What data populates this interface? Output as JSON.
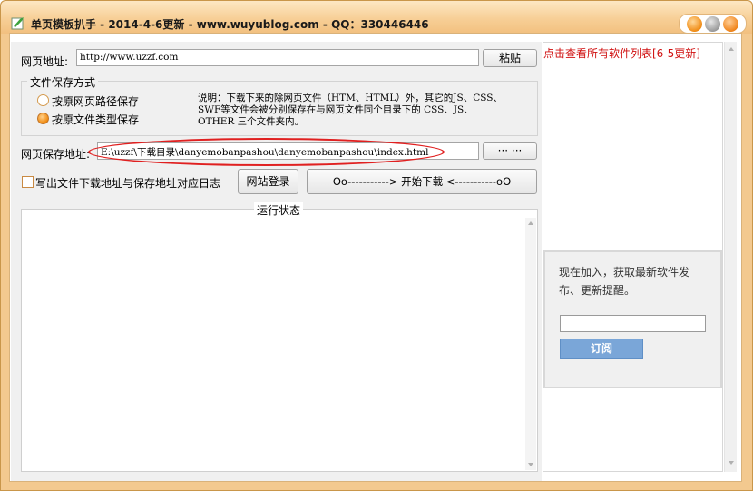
{
  "window": {
    "title": "单页模板扒手 - 2014-4-6更新 - www.wuyublog.com - QQ：330446446"
  },
  "form": {
    "url_label": "网页地址:",
    "url_value": "http://www.uzzf.com",
    "paste_button": "粘贴",
    "save_mode_group_title": "文件保存方式",
    "radio_options": [
      "按原网页路径保存",
      "按原文件类型保存"
    ],
    "selected_radio": 1,
    "description_lines": [
      "说明：下载下来的除网页文件（HTM、HTML）外，其它的JS、CSS、",
      "SWF等文件会被分别保存在与网页文件同个目录下的 CSS、JS、",
      "OTHER 三个文件夹内。"
    ],
    "save_path_label": "网页保存地址:",
    "save_path_value": "E:\\uzzf\\下载目录\\danyemobanpashou\\danyemobanpashou\\index.html",
    "browse_button": "··· ···",
    "log_checkbox_label": "写出文件下载地址与保存地址对应日志",
    "log_checkbox_checked": false,
    "site_login_button": "网站登录",
    "start_button": "Oo-----------> 开始下载 <-----------oO",
    "status_title": "运行状态"
  },
  "sidebar": {
    "list_link": "点击查看所有软件列表[6-5更新]",
    "subscribe_text": "现在加入，获取最新软件发布、更新提醒。",
    "subscribe_input_value": "",
    "subscribe_button": "订阅"
  },
  "colors": {
    "window_frame": "#f3c98f",
    "link_red": "#d01010",
    "highlight_oval": "#e02020",
    "subscribe_button": "#7aa6d8"
  }
}
